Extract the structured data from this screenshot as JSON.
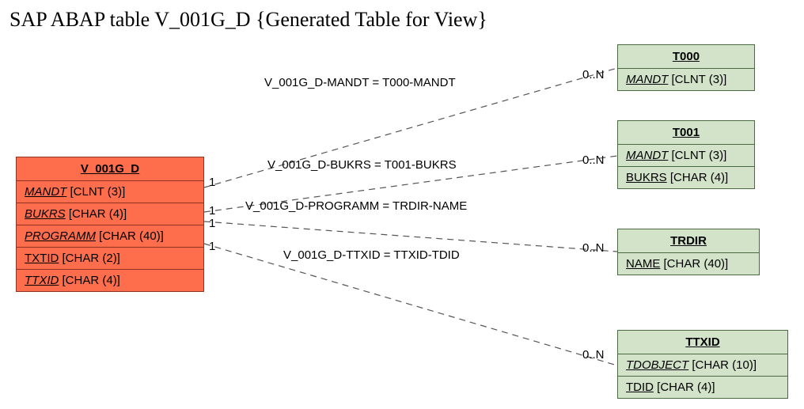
{
  "title": "SAP ABAP table V_001G_D {Generated Table for View}",
  "main_entity": {
    "name": "V_001G_D",
    "fields": [
      {
        "name": "MANDT",
        "type": "[CLNT (3)]",
        "key": true
      },
      {
        "name": "BUKRS",
        "type": "[CHAR (4)]",
        "key": true
      },
      {
        "name": "PROGRAMM",
        "type": "[CHAR (40)]",
        "key": true
      },
      {
        "name": "TXTID",
        "type": "[CHAR (2)]",
        "key": false
      },
      {
        "name": "TTXID",
        "type": "[CHAR (4)]",
        "key": true
      }
    ]
  },
  "related": [
    {
      "name": "T000",
      "fields": [
        {
          "name": "MANDT",
          "type": "[CLNT (3)]",
          "key": true
        }
      ]
    },
    {
      "name": "T001",
      "fields": [
        {
          "name": "MANDT",
          "type": "[CLNT (3)]",
          "key": true
        },
        {
          "name": "BUKRS",
          "type": "[CHAR (4)]",
          "key": false
        }
      ]
    },
    {
      "name": "TRDIR",
      "fields": [
        {
          "name": "NAME",
          "type": "[CHAR (40)]",
          "key": false
        }
      ]
    },
    {
      "name": "TTXID",
      "fields": [
        {
          "name": "TDOBJECT",
          "type": "[CHAR (10)]",
          "key": true
        },
        {
          "name": "TDID",
          "type": "[CHAR (4)]",
          "key": false
        }
      ]
    }
  ],
  "relations": [
    {
      "label": "V_001G_D-MANDT = T000-MANDT",
      "left_card": "1",
      "right_card": "0..N"
    },
    {
      "label": "V_001G_D-BUKRS = T001-BUKRS",
      "left_card": "1",
      "right_card": "0..N"
    },
    {
      "label": "V_001G_D-PROGRAMM = TRDIR-NAME",
      "left_card": "1",
      "right_card": "0..N"
    },
    {
      "label": "V_001G_D-TTXID = TTXID-TDID",
      "left_card": "1",
      "right_card": "0..N"
    }
  ]
}
